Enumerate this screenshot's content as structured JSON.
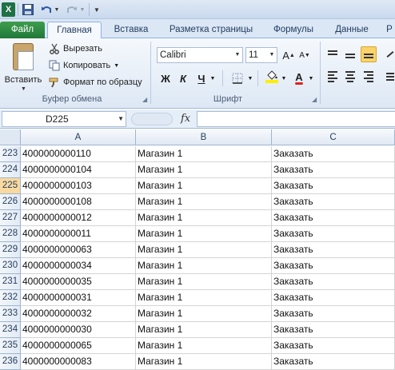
{
  "title_bar": {
    "logo_letter": "X"
  },
  "tabs": [
    {
      "label": "Файл"
    },
    {
      "label": "Главная"
    },
    {
      "label": "Вставка"
    },
    {
      "label": "Разметка страницы"
    },
    {
      "label": "Формулы"
    },
    {
      "label": "Данные"
    },
    {
      "label": "Р"
    }
  ],
  "clipboard": {
    "paste_label": "Вставить",
    "cut_label": "Вырезать",
    "copy_label": "Копировать",
    "format_painter_label": "Формат по образцу",
    "group_label": "Буфер обмена"
  },
  "font": {
    "font_name": "Calibri",
    "font_size": "11",
    "bold_label": "Ж",
    "italic_label": "К",
    "underline_label": "Ч",
    "grow_label": "A",
    "shrink_label": "A",
    "fill_label": "◆",
    "color_label": "A",
    "group_label": "Шрифт"
  },
  "colors": {
    "font_color": "#e0201b",
    "fill_color": "#ffee00",
    "selected_row": "#f9d99f"
  },
  "formula_bar": {
    "name_box": "D225",
    "fx_label": "fx",
    "formula": ""
  },
  "grid": {
    "columns": [
      "A",
      "B",
      "C"
    ],
    "selected_row": "225",
    "rows": [
      {
        "num": "223",
        "a": "4000000000110",
        "b": "Магазин 1",
        "c": "Заказать"
      },
      {
        "num": "224",
        "a": "4000000000104",
        "b": "Магазин 1",
        "c": "Заказать"
      },
      {
        "num": "225",
        "a": "4000000000103",
        "b": "Магазин 1",
        "c": "Заказать"
      },
      {
        "num": "226",
        "a": "4000000000108",
        "b": "Магазин 1",
        "c": "Заказать"
      },
      {
        "num": "227",
        "a": "4000000000012",
        "b": "Магазин 1",
        "c": "Заказать"
      },
      {
        "num": "228",
        "a": "4000000000011",
        "b": "Магазин 1",
        "c": "Заказать"
      },
      {
        "num": "229",
        "a": "4000000000063",
        "b": "Магазин 1",
        "c": "Заказать"
      },
      {
        "num": "230",
        "a": "4000000000034",
        "b": "Магазин 1",
        "c": "Заказать"
      },
      {
        "num": "231",
        "a": "4000000000035",
        "b": "Магазин 1",
        "c": "Заказать"
      },
      {
        "num": "232",
        "a": "4000000000031",
        "b": "Магазин 1",
        "c": "Заказать"
      },
      {
        "num": "233",
        "a": "4000000000032",
        "b": "Магазин 1",
        "c": "Заказать"
      },
      {
        "num": "234",
        "a": "4000000000030",
        "b": "Магазин 1",
        "c": "Заказать"
      },
      {
        "num": "235",
        "a": "4000000000065",
        "b": "Магазин 1",
        "c": "Заказать"
      },
      {
        "num": "236",
        "a": "4000000000083",
        "b": "Магазин 1",
        "c": "Заказать"
      }
    ]
  }
}
